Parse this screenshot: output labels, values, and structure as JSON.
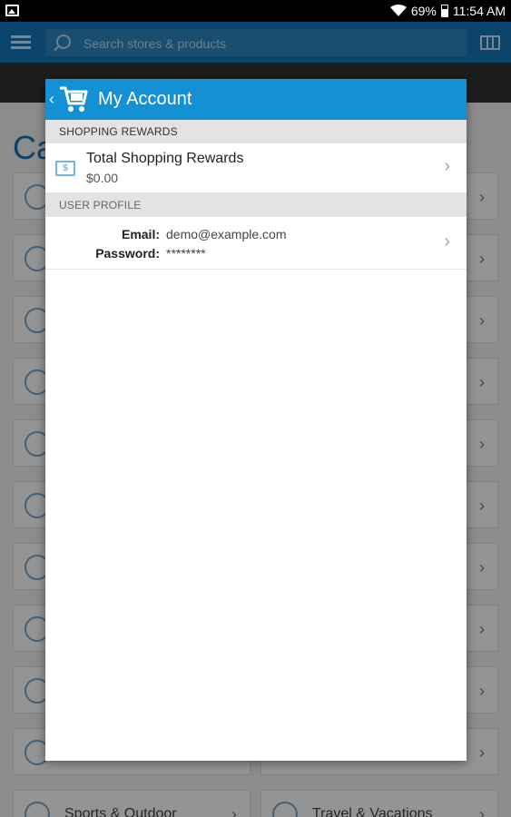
{
  "status_bar": {
    "battery_percent": "69%",
    "time": "11:54 AM"
  },
  "background": {
    "search_placeholder": "Search stores & products",
    "heading": "Ca",
    "categories": [
      {
        "label": "Sports & Outdoor"
      },
      {
        "label": "Travel & Vacations"
      }
    ]
  },
  "dialog": {
    "title": "My Account",
    "shopping_rewards": {
      "header": "SHOPPING REWARDS",
      "item_title": "Total Shopping Rewards",
      "item_value": "$0.00",
      "icon_glyph": "$"
    },
    "user_profile": {
      "header": "USER PROFILE",
      "email_label": "Email:",
      "email_value": "demo@example.com",
      "password_label": "Password:",
      "password_value": "********"
    }
  },
  "colors": {
    "accent": "#1490d4",
    "topbar": "#1478b8",
    "section_bg": "#e3e3e3"
  }
}
